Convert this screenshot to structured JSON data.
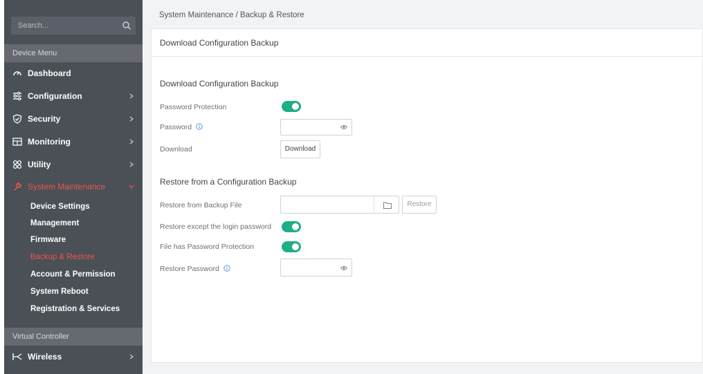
{
  "sidebar": {
    "search_placeholder": "Search...",
    "device_menu_header": "Device Menu",
    "items": [
      {
        "label": "Dashboard",
        "icon": "gauge-icon"
      },
      {
        "label": "Configuration",
        "icon": "sliders-icon"
      },
      {
        "label": "Security",
        "icon": "shield-icon"
      },
      {
        "label": "Monitoring",
        "icon": "monitor-icon"
      },
      {
        "label": "Utility",
        "icon": "grid-icon"
      },
      {
        "label": "System Maintenance",
        "icon": "wrench-icon"
      }
    ],
    "sub_items": [
      {
        "label": "Device Settings"
      },
      {
        "label": "Management"
      },
      {
        "label": "Firmware"
      },
      {
        "label": "Backup & Restore"
      },
      {
        "label": "Account & Permission"
      },
      {
        "label": "System Reboot"
      },
      {
        "label": "Registration & Services"
      }
    ],
    "virtual_controller_header": "Virtual Controller",
    "wireless_label": "Wireless"
  },
  "breadcrumb": "System Maintenance / Backup & Restore",
  "panel": {
    "title": "Download Configuration Backup",
    "download_section": {
      "heading": "Download Configuration Backup",
      "password_protection_label": "Password Protection",
      "password_label": "Password",
      "download_label": "Download",
      "download_button": "Download"
    },
    "restore_section": {
      "heading": "Restore from a Configuration Backup",
      "restore_file_label": "Restore from Backup File",
      "restore_button": "Restore",
      "except_login_label": "Restore except the login password",
      "file_protection_label": "File has Password Protection",
      "restore_password_label": "Restore Password"
    }
  },
  "colors": {
    "accent_active": "#e8584a",
    "toggle_on": "#1fae87",
    "sidebar_bg": "#4b4f56"
  }
}
